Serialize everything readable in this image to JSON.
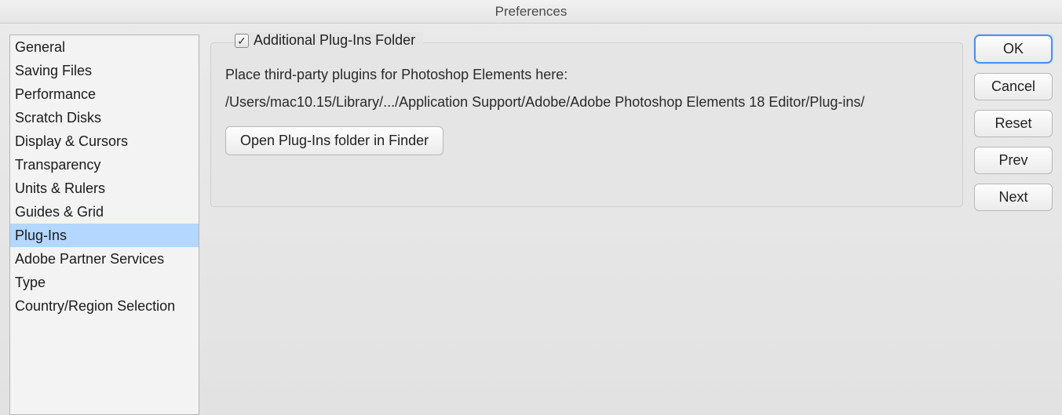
{
  "window": {
    "title": "Preferences"
  },
  "sidebar": {
    "items": [
      {
        "label": "General"
      },
      {
        "label": "Saving Files"
      },
      {
        "label": "Performance"
      },
      {
        "label": "Scratch Disks"
      },
      {
        "label": "Display & Cursors"
      },
      {
        "label": "Transparency"
      },
      {
        "label": "Units & Rulers"
      },
      {
        "label": "Guides & Grid"
      },
      {
        "label": "Plug-Ins"
      },
      {
        "label": "Adobe Partner Services"
      },
      {
        "label": "Type"
      },
      {
        "label": "Country/Region Selection"
      }
    ],
    "selected_index": 8
  },
  "plugins_panel": {
    "checkbox_checked": true,
    "checkbox_glyph": "✓",
    "group_title": "Additional Plug-Ins Folder",
    "instruction": "Place third-party plugins for Photoshop Elements here:",
    "path": "/Users/mac10.15/Library/.../Application Support/Adobe/Adobe Photoshop Elements 18 Editor/Plug-ins/",
    "open_button": "Open Plug-Ins folder in Finder"
  },
  "buttons": {
    "ok": "OK",
    "cancel": "Cancel",
    "reset": "Reset",
    "prev": "Prev",
    "next": "Next"
  }
}
